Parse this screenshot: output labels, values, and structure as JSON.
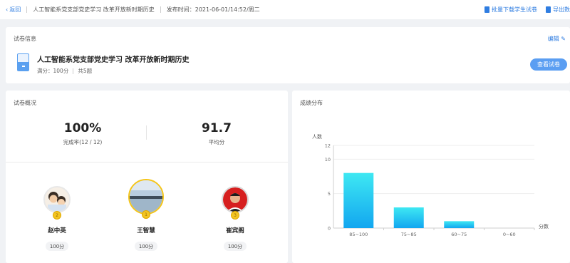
{
  "topbar": {
    "back_label": "返回",
    "exam_title": "人工智能系党支部党史学习 改革开放新时期历史",
    "publish_time": "发布时间：2021-06-01/14:52/周二",
    "download_label": "批量下载学生试卷",
    "export_label": "导出数"
  },
  "info": {
    "section_title": "试卷信息",
    "edit_label": "编辑",
    "paper_name": "人工智能系党支部党史学习 改革开放新时期历史",
    "full_score": "满分：100分",
    "question_count": "共5题",
    "view_button": "查看试卷"
  },
  "overview": {
    "section_title": "试卷概况",
    "completion_value": "100%",
    "completion_label": "完成率(12 / 12)",
    "average_value": "91.7",
    "average_label": "平均分",
    "students": [
      {
        "name": "赵中英",
        "score": "100分",
        "rank": "2"
      },
      {
        "name": "王智慧",
        "score": "100分",
        "rank": "1"
      },
      {
        "name": "崔宾阁",
        "score": "100分",
        "rank": "3"
      }
    ]
  },
  "distribution": {
    "section_title": "成绩分布"
  },
  "chart_data": {
    "type": "bar",
    "ylabel": "人数",
    "xlabel": "分数",
    "categories": [
      "85~100",
      "75~85",
      "60~75",
      "0~60"
    ],
    "values": [
      8,
      3,
      1,
      0
    ],
    "yticks": [
      0,
      5,
      10,
      12
    ],
    "ylim": [
      0,
      12
    ],
    "bar_color_top": "#3ee8f2",
    "bar_color_bottom": "#12a6f0"
  },
  "colors": {
    "accent": "#2f7de1",
    "button": "#5b9ef2",
    "medal": "#f3c521"
  }
}
